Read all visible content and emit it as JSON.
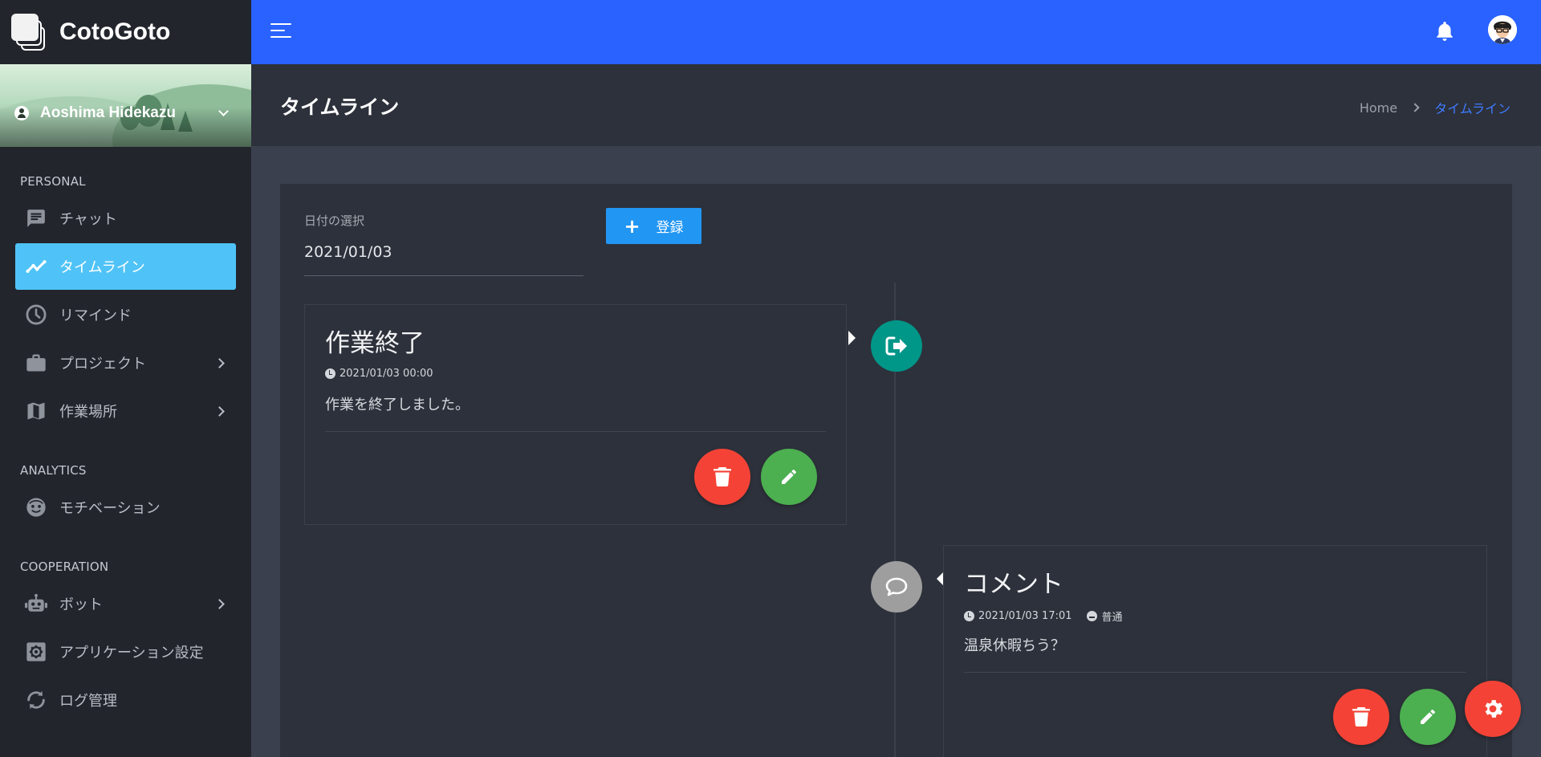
{
  "app": {
    "name": "CotoGoto"
  },
  "user": {
    "name": "Aoshima Hidekazu"
  },
  "sidebar": {
    "sections": [
      {
        "title": "PERSONAL"
      },
      {
        "title": "ANALYTICS"
      },
      {
        "title": "COOPERATION"
      }
    ],
    "items": [
      {
        "label": "チャット",
        "icon": "chat-icon"
      },
      {
        "label": "タイムライン",
        "icon": "timeline-icon",
        "active": true
      },
      {
        "label": "リマインド",
        "icon": "clock-icon"
      },
      {
        "label": "プロジェクト",
        "icon": "briefcase-icon",
        "expandable": true
      },
      {
        "label": "作業場所",
        "icon": "map-icon",
        "expandable": true
      },
      {
        "label": "モチベーション",
        "icon": "face-icon"
      },
      {
        "label": "ボット",
        "icon": "robot-icon",
        "expandable": true
      },
      {
        "label": "アプリケーション設定",
        "icon": "settings-box-icon"
      },
      {
        "label": "ログ管理",
        "icon": "sync-icon"
      }
    ]
  },
  "topbar": {
    "accent": "#2962ff"
  },
  "header": {
    "title": "タイムライン",
    "breadcrumb": {
      "home": "Home",
      "current": "タイムライン"
    }
  },
  "filter": {
    "date_label": "日付の選択",
    "date_value": "2021/01/03",
    "register_label": "登録"
  },
  "timeline": [
    {
      "title": "作業終了",
      "datetime": "2021/01/03 00:00",
      "body": "作業を終了しました。",
      "badge_icon": "exit-icon",
      "badge_color": "#009688"
    },
    {
      "title": "コメント",
      "datetime": "2021/01/03 17:01",
      "mood": "普通",
      "body": "温泉休暇ちう？",
      "badge_icon": "comment-icon",
      "badge_color": "#9e9e9e"
    }
  ]
}
